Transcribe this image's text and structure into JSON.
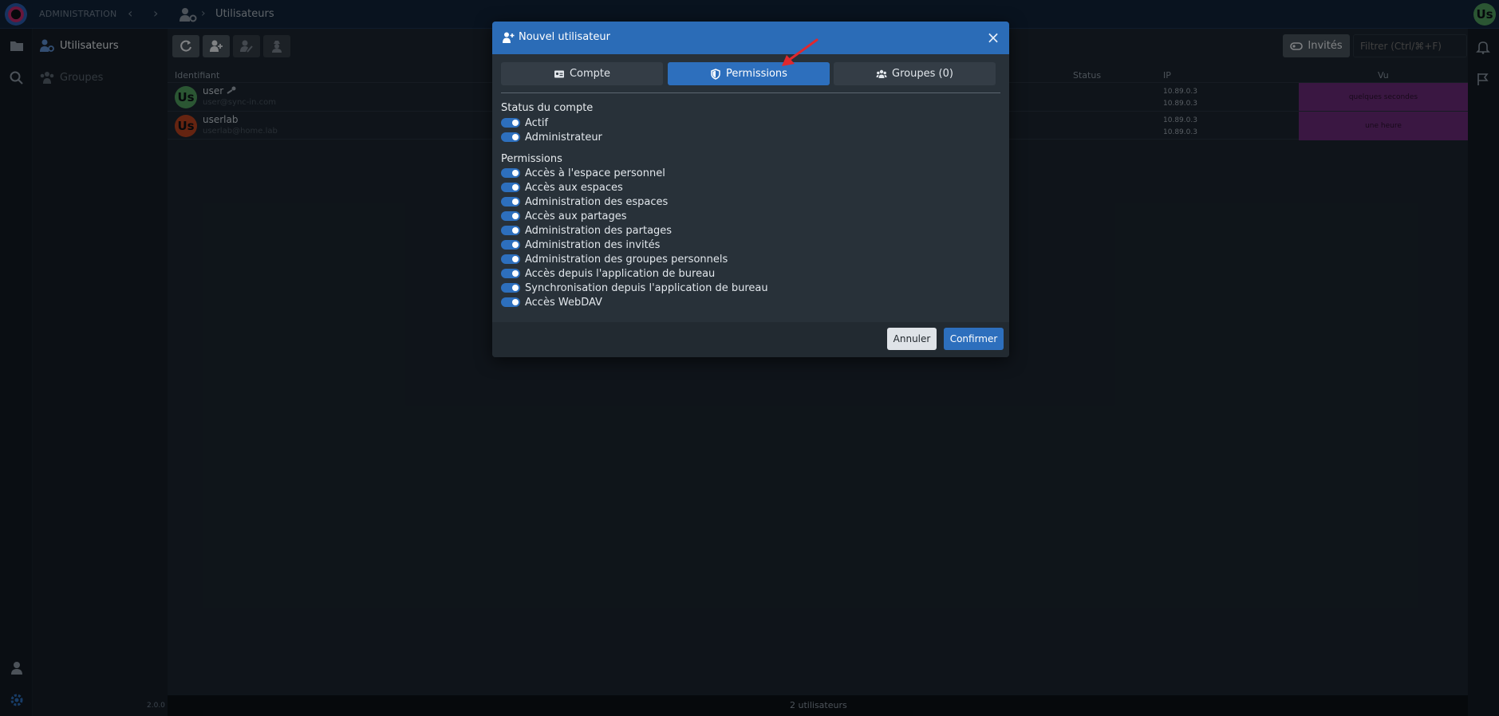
{
  "topbar": {
    "app_label": "ADMINISTRATION",
    "breadcrumb_label": "Utilisateurs",
    "avatar_initials": "Us"
  },
  "sidebar": {
    "items": [
      {
        "label": "Utilisateurs",
        "icon": "users-gear-icon"
      },
      {
        "label": "Groupes",
        "icon": "groups-icon"
      }
    ],
    "version": "2.0.0"
  },
  "main": {
    "toolbar": {
      "invites_label": "Invités",
      "filter_placeholder": "Filtrer (Ctrl/⌘+F)"
    },
    "columns": {
      "identifier": "Identifiant",
      "status": "Status",
      "ip": "IP",
      "seen": "Vu"
    },
    "rows": [
      {
        "initials": "Us",
        "name": "user",
        "email": "user@sync-in.com",
        "status": "",
        "ip1": "10.89.0.3",
        "ip2": "10.89.0.3",
        "seen": "quelques secondes"
      },
      {
        "initials": "Us",
        "name": "userlab",
        "email": "userlab@home.lab",
        "status": "",
        "ip1": "10.89.0.3",
        "ip2": "10.89.0.3",
        "seen": "une heure"
      }
    ],
    "footer_count": "2 utilisateurs"
  },
  "modal": {
    "title": "Nouvel utilisateur",
    "tabs": [
      {
        "label": "Compte"
      },
      {
        "label": "Permissions"
      },
      {
        "label": "Groupes (0)"
      }
    ],
    "account_status_title": "Status du compte",
    "account_status": [
      {
        "label": "Actif"
      },
      {
        "label": "Administrateur"
      }
    ],
    "permissions_title": "Permissions",
    "permissions": [
      {
        "label": "Accès à l'espace personnel"
      },
      {
        "label": "Accès aux espaces"
      },
      {
        "label": "Administration des espaces"
      },
      {
        "label": "Accès aux partages"
      },
      {
        "label": "Administration des partages"
      },
      {
        "label": "Administration des invités"
      },
      {
        "label": "Administration des groupes personnels"
      },
      {
        "label": "Accès depuis l'application de bureau"
      },
      {
        "label": "Synchronisation depuis l'application de bureau"
      },
      {
        "label": "Accès WebDAV"
      }
    ],
    "cancel_label": "Annuler",
    "confirm_label": "Confirmer"
  },
  "colors": {
    "accent": "#2d6fbd",
    "header": "#12243a",
    "seen_badge": "#6a2b78",
    "annotation_arrow": "#e0282e"
  }
}
